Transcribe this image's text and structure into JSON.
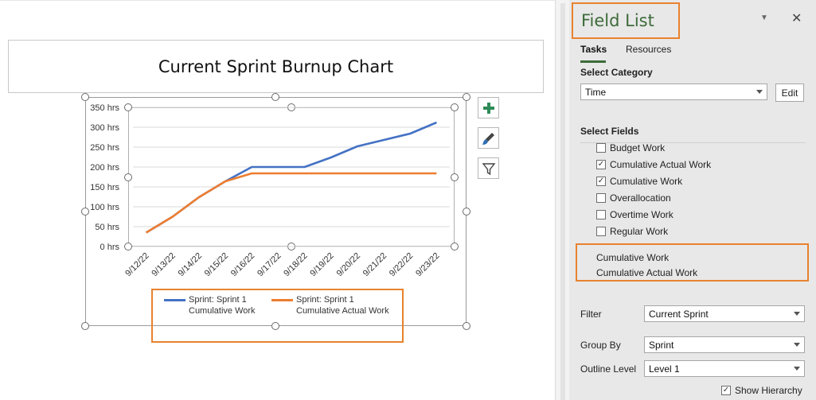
{
  "chart": {
    "title": "Current Sprint Burnup Chart"
  },
  "chart_data": {
    "type": "line",
    "categories": [
      "9/12/22",
      "9/13/22",
      "9/14/22",
      "9/15/22",
      "9/16/22",
      "9/17/22",
      "9/18/22",
      "9/19/22",
      "9/20/22",
      "9/21/22",
      "9/22/22",
      "9/23/22"
    ],
    "y_ticks": [
      "0 hrs",
      "50 hrs",
      "100 hrs",
      "150 hrs",
      "200 hrs",
      "250 hrs",
      "300 hrs",
      "350 hrs"
    ],
    "ylim": [
      0,
      350
    ],
    "grid": true,
    "legend": "bottom",
    "series": [
      {
        "name": "Sprint: Sprint 1 Cumulative Work",
        "name_lines": [
          "Sprint: Sprint 1",
          "Cumulative Work"
        ],
        "color": "#4472c4",
        "values": [
          35,
          75,
          124,
          164,
          200,
          200,
          200,
          224,
          252,
          268,
          284,
          312
        ]
      },
      {
        "name": "Sprint: Sprint 1 Cumulative Actual Work",
        "name_lines": [
          "Sprint: Sprint 1",
          "Cumulative Actual Work"
        ],
        "color": "#ed7d31",
        "values": [
          35,
          75,
          124,
          164,
          184,
          184,
          184,
          184,
          184,
          184,
          184,
          184
        ]
      }
    ]
  },
  "chart_tools": {
    "add_icon": "plus-icon",
    "style_icon": "brush-icon",
    "filter_icon": "funnel-icon"
  },
  "field_list": {
    "title": "Field List",
    "menu_icon": "dropdown-triangle-icon",
    "close_glyph": "✕",
    "tabs": [
      {
        "label": "Tasks",
        "active": true
      },
      {
        "label": "Resources",
        "active": false
      }
    ],
    "select_category_label": "Select Category",
    "category_value": "Time",
    "edit_label": "Edit",
    "select_fields_label": "Select Fields",
    "fields": [
      {
        "label": "Budget Work",
        "checked": false
      },
      {
        "label": "Cumulative Actual Work",
        "checked": true
      },
      {
        "label": "Cumulative Work",
        "checked": true
      },
      {
        "label": "Overallocation",
        "checked": false
      },
      {
        "label": "Overtime Work",
        "checked": false
      },
      {
        "label": "Regular Work",
        "checked": false
      }
    ],
    "chosen_fields": [
      "Cumulative Work",
      "Cumulative Actual Work"
    ],
    "filter_label": "Filter",
    "filter_value": "Current Sprint",
    "group_by_label": "Group By",
    "group_by_value": "Sprint",
    "outline_level_label": "Outline Level",
    "outline_level_value": "Level 1",
    "show_hierarchy_label": "Show Hierarchy",
    "show_hierarchy_checked": true
  },
  "colors": {
    "accent_orange": "#e8822e",
    "pane_title_green": "#3d6b3a",
    "tool_plus_green": "#2e8b57",
    "tool_brush_blue": "#2f6fb3"
  }
}
